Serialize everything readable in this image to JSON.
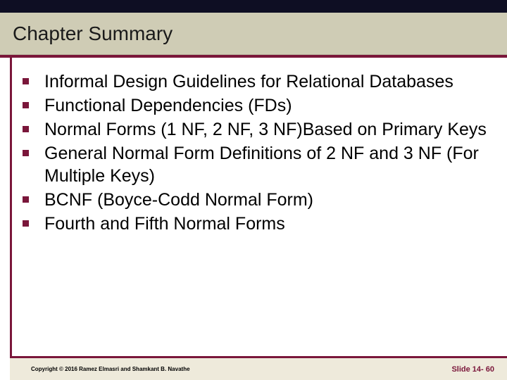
{
  "title": "Chapter Summary",
  "bullets": [
    "Informal Design Guidelines for Relational Databases",
    "Functional Dependencies (FDs)",
    "Normal Forms (1 NF, 2 NF, 3 NF)Based on Primary Keys",
    "General Normal Form Definitions of 2 NF and 3 NF (For Multiple Keys)",
    "BCNF (Boyce-Codd Normal Form)",
    "Fourth and Fifth Normal Forms"
  ],
  "copyright": "Copyright © 2016 Ramez Elmasri and Shamkant B. Navathe",
  "slidenum": "Slide 14- 60"
}
